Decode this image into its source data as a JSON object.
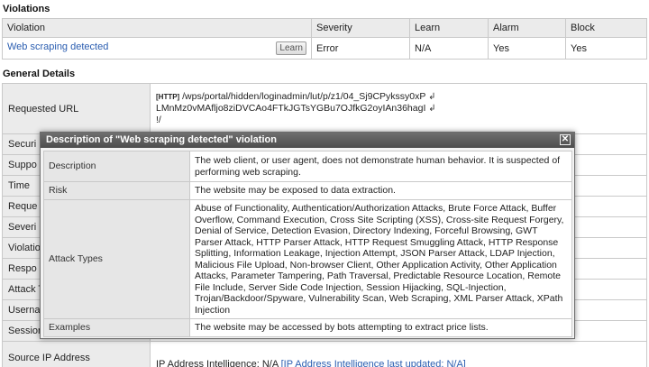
{
  "violations": {
    "title": "Violations",
    "columns": [
      "Violation",
      "Severity",
      "Learn",
      "Alarm",
      "Block"
    ],
    "row": {
      "violation": "Web scraping detected",
      "learn_button": "Learn",
      "severity": "Error",
      "learn": "N/A",
      "alarm": "Yes",
      "block": "Yes"
    }
  },
  "general": {
    "title": "General Details",
    "requested_url_label": "Requested URL",
    "http_tag": "[HTTP]",
    "url_lines": [
      "/wps/portal/hidden/loginadmin/lut/p/z1/04_Sj9CPykssy0xP",
      "LMnMz0vMAfljo8ziDVCAo4FTkJGTsYGBu7OJfkG2oyIAn36hagI",
      "!/"
    ],
    "wrap_glyph": "↲",
    "rows": [
      {
        "label": "Securi",
        "value": ""
      },
      {
        "label": "Suppo",
        "value": ""
      },
      {
        "label": "Time",
        "value": ""
      },
      {
        "label": "Reque",
        "value": ""
      },
      {
        "label": "Severi",
        "value": ""
      },
      {
        "label": "Violatio",
        "value": ""
      },
      {
        "label": "Respo",
        "value": ""
      },
      {
        "label": "Attack T",
        "value": ""
      },
      {
        "label": "Userna",
        "value": ""
      },
      {
        "label": "Session",
        "value": ""
      }
    ],
    "source_ip_label": "Source IP Address",
    "ip_intel_prefix": "IP Address Intelligence: N/A",
    "ip_intel_link": "[IP Address Intelligence last updated: N/A]"
  },
  "modal": {
    "title": "Description of \"Web scraping detected\" violation",
    "close_glyph": "✕",
    "rows": [
      {
        "label": "Description",
        "value": "The web client, or user agent, does not demonstrate human behavior. It is suspected of performing web scraping."
      },
      {
        "label": "Risk",
        "value": "The website may be exposed to data extraction."
      },
      {
        "label": "Attack Types",
        "value": "Abuse of Functionality, Authentication/Authorization Attacks, Brute Force Attack, Buffer Overflow, Command Execution, Cross Site Scripting (XSS), Cross-site Request Forgery, Denial of Service, Detection Evasion, Directory Indexing, Forceful Browsing, GWT Parser Attack, HTTP Parser Attack, HTTP Request Smuggling Attack, HTTP Response Splitting, Information Leakage, Injection Attempt, JSON Parser Attack, LDAP Injection, Malicious File Upload, Non-browser Client, Other Application Activity, Other Application Attacks, Parameter Tampering, Path Traversal, Predictable Resource Location, Remote File Include, Server Side Code Injection, Session Hijacking, SQL-Injection, Trojan/Backdoor/Spyware, Vulnerability Scan, Web Scraping, XML Parser Attack, XPath Injection"
      },
      {
        "label": "Examples",
        "value": "The website may be accessed by bots attempting to extract price lists."
      }
    ]
  }
}
